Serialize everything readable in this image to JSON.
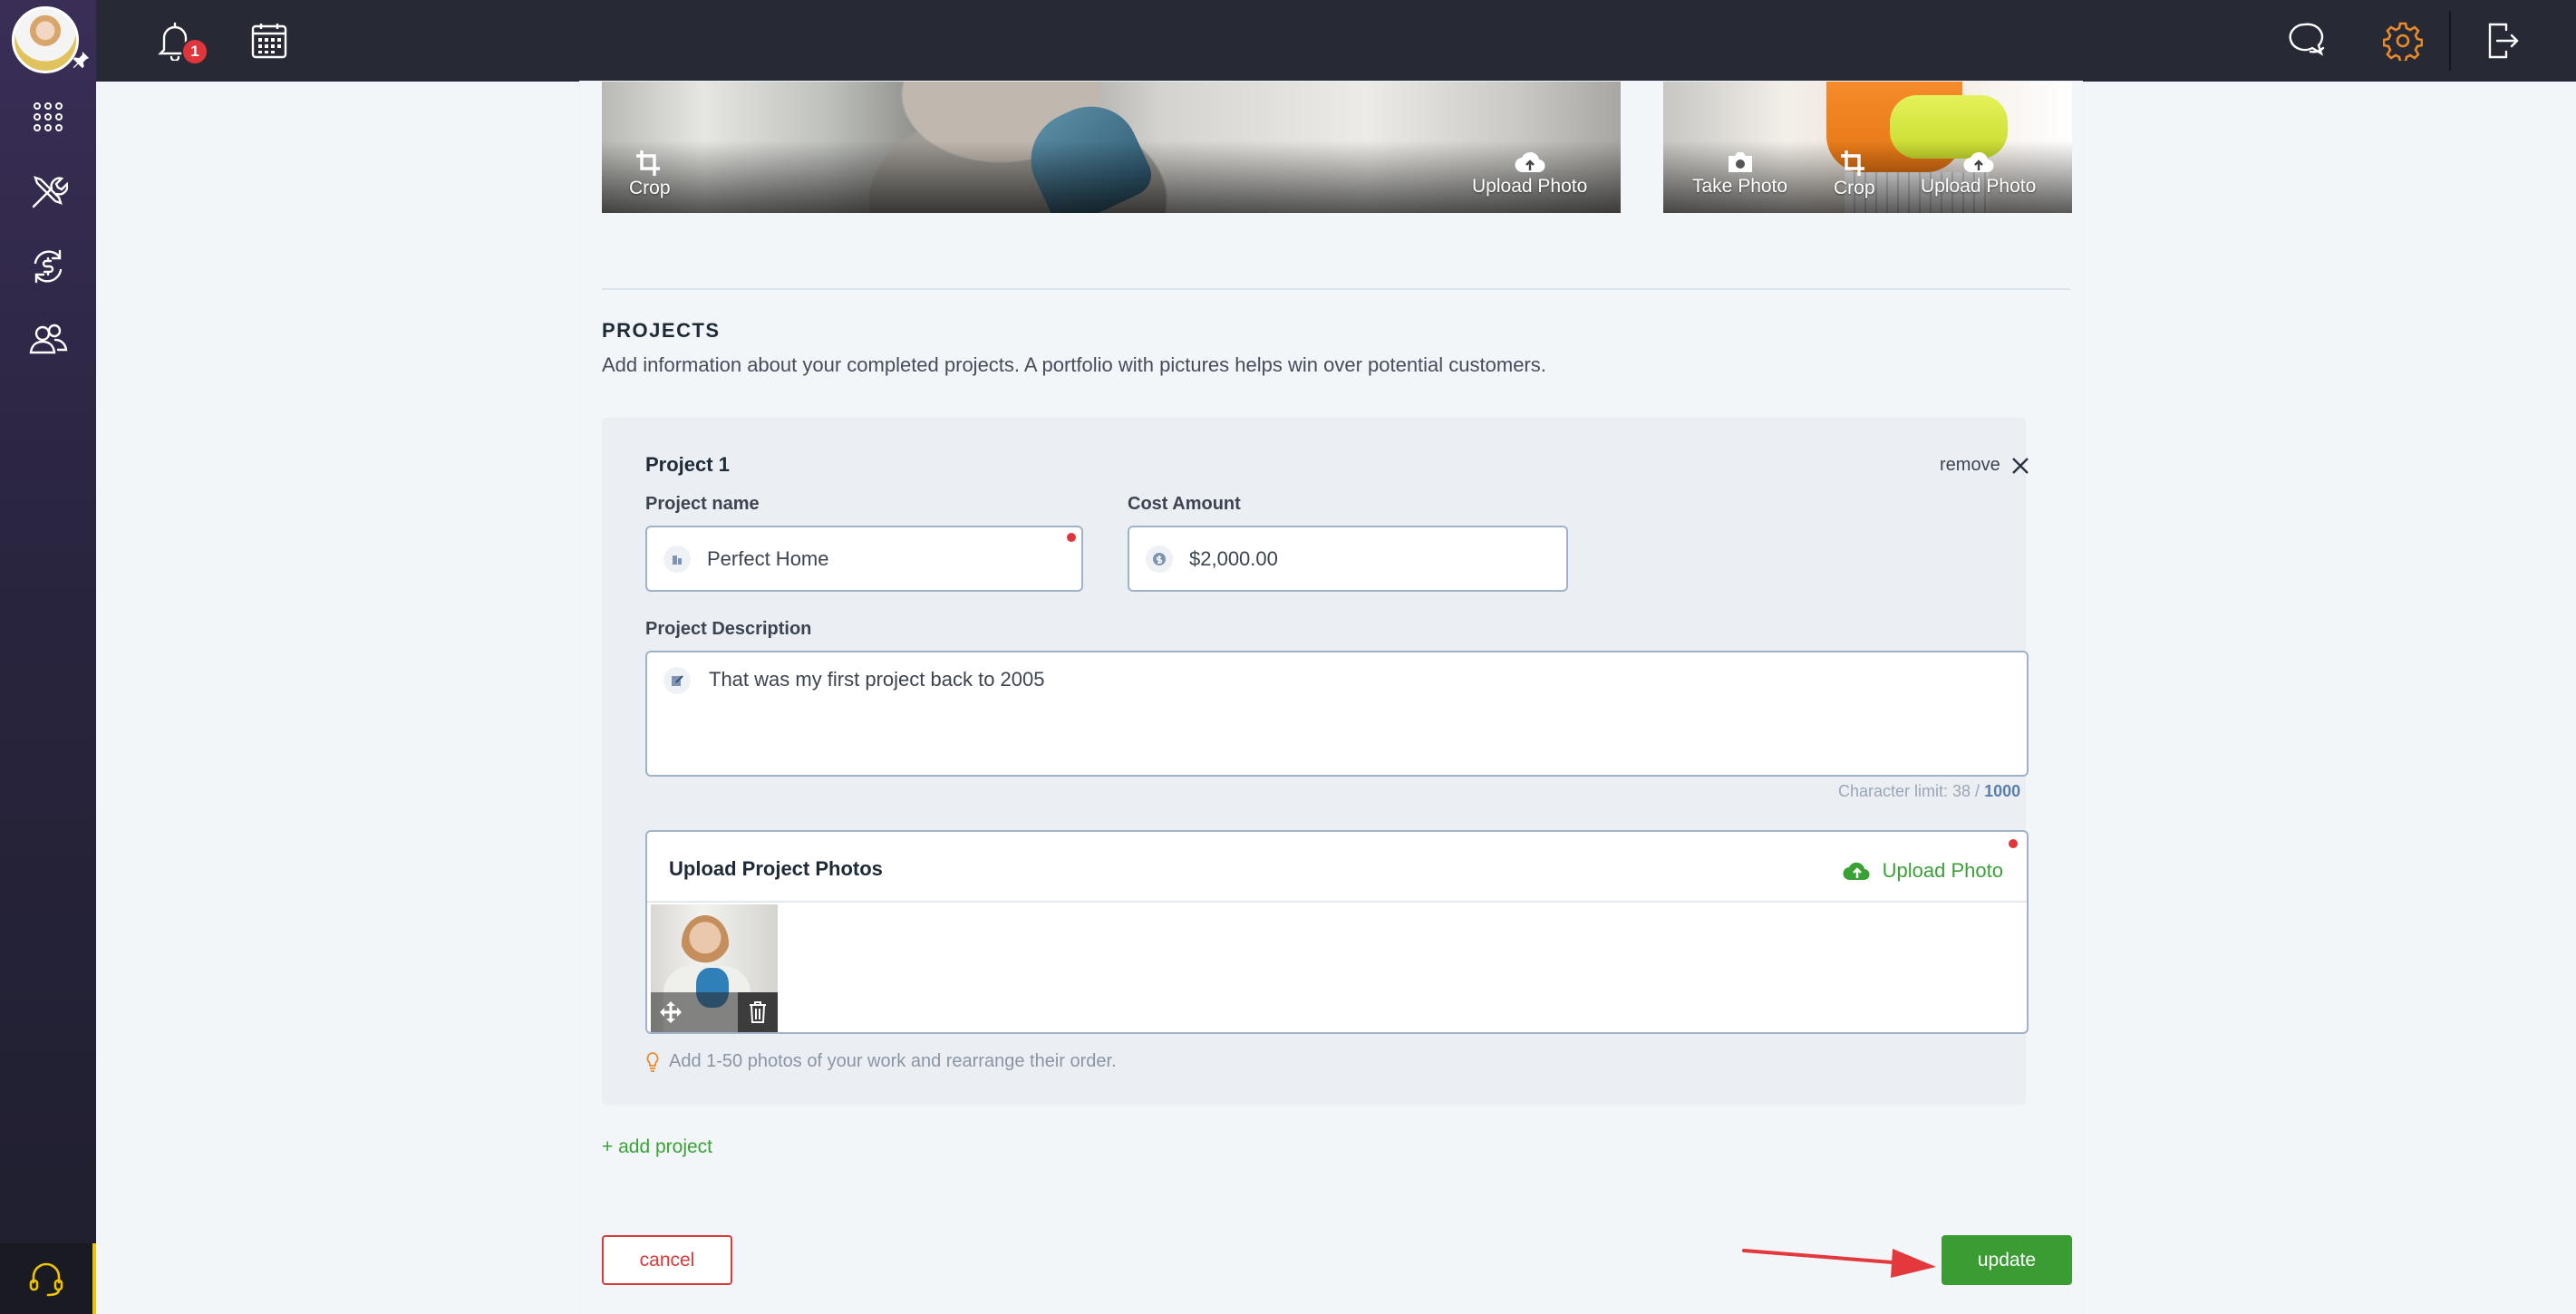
{
  "topbar": {
    "notification_count": "1"
  },
  "cover_photo": {
    "crop_label": "Crop",
    "upload_label": "Upload Photo"
  },
  "profile_photo": {
    "take_label": "Take Photo",
    "crop_label": "Crop",
    "upload_label": "Upload Photo"
  },
  "projects": {
    "title": "PROJECTS",
    "description": "Add information about your completed projects. A portfolio with pictures helps win over potential customers.",
    "items": [
      {
        "title": "Project 1",
        "remove_label": "remove",
        "name_label": "Project name",
        "name_value": "Perfect Home",
        "cost_label": "Cost Amount",
        "cost_value": "$2,000.00",
        "description_label": "Project Description",
        "description_value": "That was my first project back to 2005",
        "char_limit_prefix": "Character limit: 38 / ",
        "char_limit_max": "1000",
        "photos_title": "Upload Project Photos",
        "photos_upload_label": "Upload Photo",
        "photos_hint": "Add 1-50 photos of your work and rearrange their order."
      }
    ],
    "add_label": "+ add project"
  },
  "actions": {
    "cancel_label": "cancel",
    "update_label": "update"
  },
  "colors": {
    "accent_green": "#3b9c34",
    "danger_red": "#d83a3a",
    "gear_orange": "#e98a2d"
  }
}
